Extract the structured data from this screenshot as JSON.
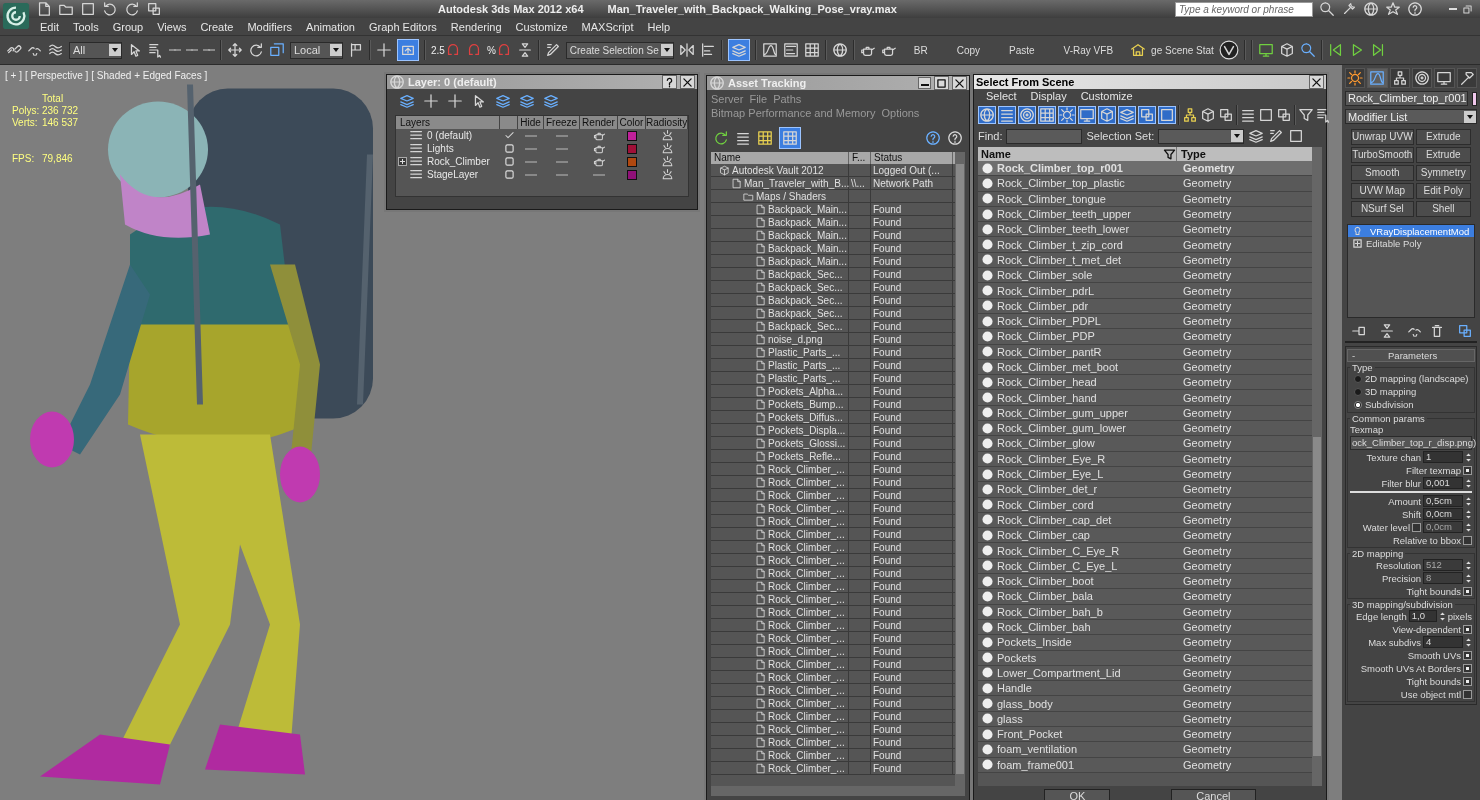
{
  "title_bar": {
    "app": "Autodesk 3ds Max  2012 x64",
    "file": "Man_Traveler_with_Backpack_Walking_Pose_vray.max",
    "search": {
      "placeholder": "Type a keyword or phrase"
    }
  },
  "menu": [
    "Edit",
    "Tools",
    "Group",
    "Views",
    "Create",
    "Modifiers",
    "Animation",
    "Graph Editors",
    "Rendering",
    "Customize",
    "MAXScript",
    "Help"
  ],
  "toolbar": {
    "selection_filter": "All",
    "reference_coord": "Local",
    "snap_label": "2.5",
    "percent_snap_label": "%",
    "named_selection": "Create Selection Se",
    "manipulate_on": true,
    "layer_manager_on": true,
    "text_buttons": [
      "BR",
      "Copy",
      "Paste",
      "V-Ray VFB"
    ],
    "scene_states": "ge Scene Stat"
  },
  "viewport": {
    "labels": [
      "[ + ]",
      "[ Perspective ]",
      "[ Shaded + Edged Faces ]"
    ],
    "stats": {
      "heading": "Total",
      "rows": [
        {
          "label": "Polys:",
          "value": "236 732"
        },
        {
          "label": "Verts:",
          "value": "146 537"
        }
      ],
      "fps_label": "FPS:",
      "fps": "79,846"
    }
  },
  "layer_dialog": {
    "title": "Layer: 0 (default)",
    "columns": [
      "Layers",
      "Hide",
      "Freeze",
      "Render",
      "Color",
      "Radiosity"
    ],
    "rows": [
      {
        "name": "0 (default)",
        "current": true,
        "hidden": false,
        "frozen": false,
        "renderable": true,
        "color": "#c0209a"
      },
      {
        "name": "Lights",
        "current": false,
        "hidden": false,
        "frozen": false,
        "renderable": true,
        "color": "#a01038"
      },
      {
        "name": "Rock_Climber",
        "current": false,
        "hidden": false,
        "frozen": false,
        "renderable": true,
        "color": "#b04810",
        "expanded": false
      },
      {
        "name": "StageLayer",
        "current": false,
        "hidden": false,
        "frozen": false,
        "renderable": false,
        "color": "#901078"
      }
    ]
  },
  "asset_tracking": {
    "title": "Asset Tracking",
    "menu": [
      "Server",
      "File",
      "Paths",
      "Bitmap Performance and Memory",
      "Options"
    ],
    "columns": [
      "Name",
      "F...",
      "Status"
    ],
    "tree": [
      {
        "kind": "vault",
        "name": "Autodesk Vault 2012",
        "status": "Logged Out (...",
        "children": [
          {
            "kind": "file",
            "name": "Man_Traveler_with_B...",
            "column_2": "\\\\...",
            "status": "Network Path",
            "children": [
              {
                "kind": "folder",
                "name": "Maps / Shaders",
                "children": [
                  {
                    "kind": "bitmap",
                    "name": "Backpack_Main...",
                    "status": "Found"
                  },
                  {
                    "kind": "bitmap",
                    "name": "Backpack_Main...",
                    "status": "Found"
                  },
                  {
                    "kind": "bitmap",
                    "name": "Backpack_Main...",
                    "status": "Found"
                  },
                  {
                    "kind": "bitmap",
                    "name": "Backpack_Main...",
                    "status": "Found"
                  },
                  {
                    "kind": "bitmap",
                    "name": "Backpack_Main...",
                    "status": "Found"
                  },
                  {
                    "kind": "bitmap",
                    "name": "Backpack_Sec...",
                    "status": "Found"
                  },
                  {
                    "kind": "bitmap",
                    "name": "Backpack_Sec...",
                    "status": "Found"
                  },
                  {
                    "kind": "bitmap",
                    "name": "Backpack_Sec...",
                    "status": "Found"
                  },
                  {
                    "kind": "bitmap",
                    "name": "Backpack_Sec...",
                    "status": "Found"
                  },
                  {
                    "kind": "bitmap",
                    "name": "Backpack_Sec...",
                    "status": "Found"
                  },
                  {
                    "kind": "bitmap",
                    "name": "noise_d.png",
                    "status": "Found"
                  },
                  {
                    "kind": "bitmap",
                    "name": "Plastic_Parts_...",
                    "status": "Found"
                  },
                  {
                    "kind": "bitmap",
                    "name": "Plastic_Parts_...",
                    "status": "Found"
                  },
                  {
                    "kind": "bitmap",
                    "name": "Plastic_Parts_...",
                    "status": "Found"
                  },
                  {
                    "kind": "bitmap",
                    "name": "Pockets_Alpha...",
                    "status": "Found"
                  },
                  {
                    "kind": "bitmap",
                    "name": "Pockets_Bump...",
                    "status": "Found"
                  },
                  {
                    "kind": "bitmap",
                    "name": "Pockets_Diffus...",
                    "status": "Found"
                  },
                  {
                    "kind": "bitmap",
                    "name": "Pockets_Displa...",
                    "status": "Found"
                  },
                  {
                    "kind": "bitmap",
                    "name": "Pockets_Glossi...",
                    "status": "Found"
                  },
                  {
                    "kind": "bitmap",
                    "name": "Pockets_Refle...",
                    "status": "Found"
                  },
                  {
                    "kind": "bitmap",
                    "name": "Rock_Climber_...",
                    "status": "Found"
                  },
                  {
                    "kind": "bitmap",
                    "name": "Rock_Climber_...",
                    "status": "Found"
                  },
                  {
                    "kind": "bitmap",
                    "name": "Rock_Climber_...",
                    "status": "Found"
                  },
                  {
                    "kind": "bitmap",
                    "name": "Rock_Climber_...",
                    "status": "Found"
                  },
                  {
                    "kind": "bitmap",
                    "name": "Rock_Climber_...",
                    "status": "Found"
                  },
                  {
                    "kind": "bitmap",
                    "name": "Rock_Climber_...",
                    "status": "Found"
                  },
                  {
                    "kind": "bitmap",
                    "name": "Rock_Climber_...",
                    "status": "Found"
                  },
                  {
                    "kind": "bitmap",
                    "name": "Rock_Climber_...",
                    "status": "Found"
                  },
                  {
                    "kind": "bitmap",
                    "name": "Rock_Climber_...",
                    "status": "Found"
                  },
                  {
                    "kind": "bitmap",
                    "name": "Rock_Climber_...",
                    "status": "Found"
                  },
                  {
                    "kind": "bitmap",
                    "name": "Rock_Climber_...",
                    "status": "Found"
                  },
                  {
                    "kind": "bitmap",
                    "name": "Rock_Climber_...",
                    "status": "Found"
                  },
                  {
                    "kind": "bitmap",
                    "name": "Rock_Climber_...",
                    "status": "Found"
                  },
                  {
                    "kind": "bitmap",
                    "name": "Rock_Climber_...",
                    "status": "Found"
                  },
                  {
                    "kind": "bitmap",
                    "name": "Rock_Climber_...",
                    "status": "Found"
                  },
                  {
                    "kind": "bitmap",
                    "name": "Rock_Climber_...",
                    "status": "Found"
                  },
                  {
                    "kind": "bitmap",
                    "name": "Rock_Climber_...",
                    "status": "Found"
                  },
                  {
                    "kind": "bitmap",
                    "name": "Rock_Climber_...",
                    "status": "Found"
                  },
                  {
                    "kind": "bitmap",
                    "name": "Rock_Climber_...",
                    "status": "Found"
                  },
                  {
                    "kind": "bitmap",
                    "name": "Rock_Climber_...",
                    "status": "Found"
                  },
                  {
                    "kind": "bitmap",
                    "name": "Rock_Climber_...",
                    "status": "Found"
                  },
                  {
                    "kind": "bitmap",
                    "name": "Rock_Climber_...",
                    "status": "Found"
                  },
                  {
                    "kind": "bitmap",
                    "name": "Rock_Climber_...",
                    "status": "Found"
                  },
                  {
                    "kind": "bitmap",
                    "name": "Rock_Climber_...",
                    "status": "Found"
                  }
                ]
              }
            ]
          }
        ]
      }
    ]
  },
  "select_from_scene": {
    "title": "Select From Scene",
    "menu": [
      "Select",
      "Display",
      "Customize"
    ],
    "find_label": "Find:",
    "selection_set_label": "Selection Set:",
    "columns": [
      "Name",
      "Type"
    ],
    "rows": [
      {
        "name": "Rock_Climber_top_r001",
        "type": "Geometry",
        "selected": true
      },
      {
        "name": "Rock_Climber_top_plastic",
        "type": "Geometry",
        "selected": false
      },
      {
        "name": "Rock_Climber_tongue",
        "type": "Geometry",
        "selected": false
      },
      {
        "name": "Rock_Climber_teeth_upper",
        "type": "Geometry",
        "selected": false
      },
      {
        "name": "Rock_Climber_teeth_lower",
        "type": "Geometry",
        "selected": false
      },
      {
        "name": "Rock_Climber_t_zip_cord",
        "type": "Geometry",
        "selected": false
      },
      {
        "name": "Rock_Climber_t_met_det",
        "type": "Geometry",
        "selected": false
      },
      {
        "name": "Rock_Climber_sole",
        "type": "Geometry",
        "selected": false
      },
      {
        "name": "Rock_Climber_pdrL",
        "type": "Geometry",
        "selected": false
      },
      {
        "name": "Rock_Climber_pdr",
        "type": "Geometry",
        "selected": false
      },
      {
        "name": "Rock_Climber_PDPL",
        "type": "Geometry",
        "selected": false
      },
      {
        "name": "Rock_Climber_PDP",
        "type": "Geometry",
        "selected": false
      },
      {
        "name": "Rock_Climber_pantR",
        "type": "Geometry",
        "selected": false
      },
      {
        "name": "Rock_Climber_met_boot",
        "type": "Geometry",
        "selected": false
      },
      {
        "name": "Rock_Climber_head",
        "type": "Geometry",
        "selected": false
      },
      {
        "name": "Rock_Climber_hand",
        "type": "Geometry",
        "selected": false
      },
      {
        "name": "Rock_Climber_gum_upper",
        "type": "Geometry",
        "selected": false
      },
      {
        "name": "Rock_Climber_gum_lower",
        "type": "Geometry",
        "selected": false
      },
      {
        "name": "Rock_Climber_glow",
        "type": "Geometry",
        "selected": false
      },
      {
        "name": "Rock_Climber_Eye_R",
        "type": "Geometry",
        "selected": false
      },
      {
        "name": "Rock_Climber_Eye_L",
        "type": "Geometry",
        "selected": false
      },
      {
        "name": "Rock_Climber_det_r",
        "type": "Geometry",
        "selected": false
      },
      {
        "name": "Rock_Climber_cord",
        "type": "Geometry",
        "selected": false
      },
      {
        "name": "Rock_Climber_cap_det",
        "type": "Geometry",
        "selected": false
      },
      {
        "name": "Rock_Climber_cap",
        "type": "Geometry",
        "selected": false
      },
      {
        "name": "Rock_Climber_C_Eye_R",
        "type": "Geometry",
        "selected": false
      },
      {
        "name": "Rock_Climber_C_Eye_L",
        "type": "Geometry",
        "selected": false
      },
      {
        "name": "Rock_Climber_boot",
        "type": "Geometry",
        "selected": false
      },
      {
        "name": "Rock_Climber_bala",
        "type": "Geometry",
        "selected": false
      },
      {
        "name": "Rock_Climber_bah_b",
        "type": "Geometry",
        "selected": false
      },
      {
        "name": "Rock_Climber_bah",
        "type": "Geometry",
        "selected": false
      },
      {
        "name": "Pockets_Inside",
        "type": "Geometry",
        "selected": false
      },
      {
        "name": "Pockets",
        "type": "Geometry",
        "selected": false
      },
      {
        "name": "Lower_Compartment_Lid",
        "type": "Geometry",
        "selected": false
      },
      {
        "name": "Handle",
        "type": "Geometry",
        "selected": false
      },
      {
        "name": "glass_body",
        "type": "Geometry",
        "selected": false
      },
      {
        "name": "glass",
        "type": "Geometry",
        "selected": false
      },
      {
        "name": "Front_Pocket",
        "type": "Geometry",
        "selected": false
      },
      {
        "name": "foam_ventilation",
        "type": "Geometry",
        "selected": false
      },
      {
        "name": "foam_frame001",
        "type": "Geometry",
        "selected": false
      }
    ],
    "buttons": [
      "OK",
      "Cancel"
    ]
  },
  "command_panel": {
    "tabs": [
      {
        "selected": false
      },
      {
        "selected": true
      },
      {
        "selected": false
      },
      {
        "selected": false
      },
      {
        "selected": false
      },
      {
        "selected": false
      }
    ],
    "object_name": "Rock_Climber_top_r001",
    "modifier_list": "Modifier List",
    "modifier_buttons": [
      "Unwrap UVW",
      "Extrude",
      "TurboSmooth",
      "Extrude",
      "Smooth",
      "Symmetry",
      "UVW Map",
      "Edit Poly",
      "NSurf Sel",
      "Shell"
    ],
    "stack": [
      {
        "name": "VRayDisplacementMod",
        "selected": true,
        "kind": "modifier"
      },
      {
        "name": "Editable Poly",
        "selected": false,
        "kind": "base"
      }
    ],
    "parameters": {
      "collapse_sign": "-",
      "title": "Parameters",
      "groups": [
        {
          "title": "Type",
          "items": [
            {
              "kind": "radio",
              "label": "2D mapping (landscape)",
              "selected": false
            },
            {
              "kind": "radio",
              "label": "3D mapping",
              "selected": false
            },
            {
              "kind": "radio",
              "label": "Subdivision",
              "selected": true
            }
          ]
        },
        {
          "title": "Common params",
          "items": [
            {
              "kind": "label",
              "label": "Texmap"
            },
            {
              "kind": "map_button",
              "label": "ock_Climber_top_r_disp.png)"
            },
            {
              "kind": "spinner",
              "label": "Texture chan",
              "value": "1"
            },
            {
              "kind": "check",
              "label": "Filter texmap",
              "checked": true
            },
            {
              "kind": "spinner",
              "label": "Filter blur",
              "value": "0,001"
            },
            {
              "kind": "separator"
            },
            {
              "kind": "spinner",
              "label": "Amount",
              "value": "0,5cm"
            },
            {
              "kind": "spinner",
              "label": "Shift",
              "value": "0,0cm"
            },
            {
              "kind": "check_spinner",
              "label": "Water level",
              "checked": false,
              "value": "0,0cm",
              "disabled": true
            },
            {
              "kind": "check",
              "label": "Relative to bbox",
              "checked": false
            }
          ]
        },
        {
          "title": "2D mapping",
          "items": [
            {
              "kind": "spinner",
              "label": "Resolution",
              "value": "512",
              "disabled": true
            },
            {
              "kind": "spinner",
              "label": "Precision",
              "value": "8",
              "disabled": true
            },
            {
              "kind": "check",
              "label": "Tight bounds",
              "checked": true
            }
          ]
        },
        {
          "title": "3D mapping/subdivision",
          "items": [
            {
              "kind": "spinner",
              "label": "Edge length",
              "value": "1,0",
              "unit": "pixels"
            },
            {
              "kind": "check",
              "label": "View-dependent",
              "checked": true
            },
            {
              "kind": "spinner",
              "label": "Max subdivs",
              "value": "4"
            },
            {
              "kind": "check",
              "label": "Smooth UVs",
              "checked": true
            },
            {
              "kind": "check",
              "label": "Smooth UVs At Borders",
              "checked": true
            },
            {
              "kind": "check",
              "label": "Tight bounds",
              "checked": true
            },
            {
              "kind": "check",
              "label": "Use object mtl",
              "checked": false
            }
          ]
        }
      ]
    }
  }
}
